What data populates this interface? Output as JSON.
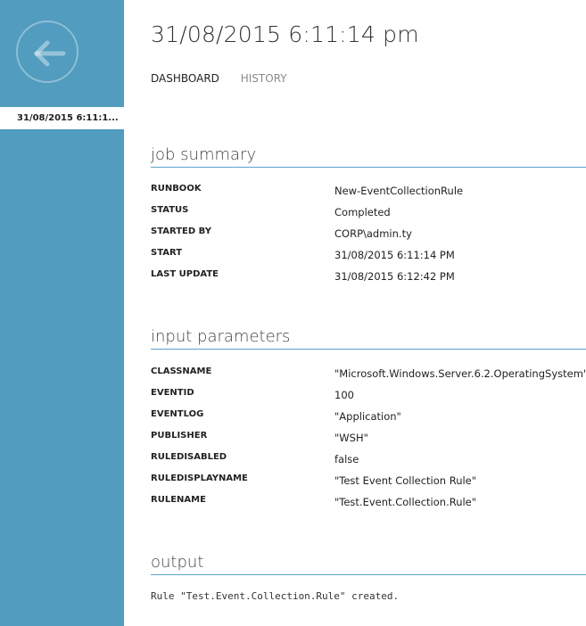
{
  "sidebar": {
    "back_icon": "back-arrow-icon",
    "items": [
      {
        "label": "31/08/2015 6:11:1..."
      }
    ],
    "colors": {
      "background": "#519cbf",
      "selected": "#ffffff"
    }
  },
  "header": {
    "title": "31/08/2015 6:11:14 pm",
    "tabs": [
      {
        "label": "DASHBOARD",
        "active": true
      },
      {
        "label": "HISTORY",
        "active": false
      }
    ]
  },
  "job_summary": {
    "title": "job summary",
    "rows": [
      {
        "key": "RUNBOOK",
        "value": "New-EventCollectionRule"
      },
      {
        "key": "STATUS",
        "value": "Completed"
      },
      {
        "key": "STARTED BY",
        "value": "CORP\\admin.ty"
      },
      {
        "key": "START",
        "value": "31/08/2015 6:11:14 PM"
      },
      {
        "key": "LAST UPDATE",
        "value": "31/08/2015 6:12:42 PM"
      }
    ]
  },
  "input_parameters": {
    "title": "input parameters",
    "rows": [
      {
        "key": "CLASSNAME",
        "value": "\"Microsoft.Windows.Server.6.2.OperatingSystem\""
      },
      {
        "key": "EVENTID",
        "value": "100"
      },
      {
        "key": "EVENTLOG",
        "value": "\"Application\""
      },
      {
        "key": "PUBLISHER",
        "value": "\"WSH\""
      },
      {
        "key": "RULEDISABLED",
        "value": "false"
      },
      {
        "key": "RULEDISPLAYNAME",
        "value": "\"Test Event Collection Rule\""
      },
      {
        "key": "RULENAME",
        "value": "\"Test.Event.Collection.Rule\""
      }
    ]
  },
  "output": {
    "title": "output",
    "text": "Rule \"Test.Event.Collection.Rule\" created."
  },
  "colors": {
    "accent_line": "#5ba3cc"
  }
}
